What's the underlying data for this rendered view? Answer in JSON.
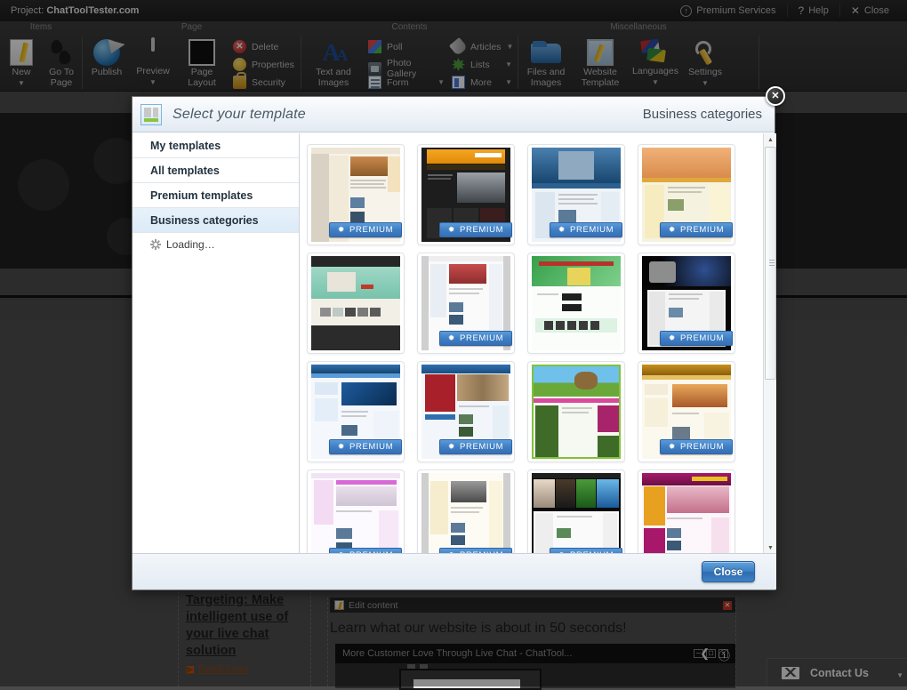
{
  "projectbar": {
    "project_label": "Project:",
    "project_name": "ChatToolTester.com",
    "premium_services": "Premium Services",
    "help": "Help",
    "close": "Close"
  },
  "ribbon": {
    "groups": [
      {
        "label": "Items"
      },
      {
        "label": "Page"
      },
      {
        "label": "Contents"
      },
      {
        "label": "Miscellaneous"
      }
    ],
    "buttons": {
      "new": "New",
      "go_to_page": "Go To\nPage",
      "publish": "Publish",
      "preview": "Preview",
      "page_layout": "Page\nLayout",
      "text_and_images": "Text and\nImages",
      "files_and_images": "Files and\nImages",
      "website_template": "Website\nTemplate",
      "languages": "Languages",
      "settings": "Settings"
    },
    "small_buttons": {
      "delete": "Delete",
      "properties": "Properties",
      "security": "Security",
      "poll": "Poll",
      "photo_gallery": "Photo Gallery",
      "form": "Form",
      "articles": "Articles",
      "lists": "Lists",
      "more": "More"
    }
  },
  "canvas": {
    "promo_title": "Targeting: Make intelligent use of your live chat solution",
    "read_more": "Read more",
    "edit_content": "Edit content",
    "main_heading": "Learn what our website is about in 50 seconds!",
    "video_title": "More Customer Love Through Live Chat - ChatTool...",
    "contact_us": "Contact Us"
  },
  "modal": {
    "title": "Select your template",
    "category": "Business categories",
    "close_button": "Close",
    "close_icon_label": "✕",
    "sidebar": [
      {
        "label": "My templates",
        "active": false
      },
      {
        "label": "All templates",
        "active": false
      },
      {
        "label": "Premium templates",
        "active": false
      },
      {
        "label": "Business categories",
        "active": true
      }
    ],
    "loading_label": "Loading…",
    "badge_label": "PREMIUM",
    "badge_star": "✹",
    "templates": [
      {
        "id": 1,
        "premium": true,
        "style": "cream-wood"
      },
      {
        "id": 2,
        "premium": true,
        "style": "orange-dark"
      },
      {
        "id": 3,
        "premium": true,
        "style": "blue-business"
      },
      {
        "id": 4,
        "premium": true,
        "style": "orange-hands"
      },
      {
        "id": 5,
        "premium": false,
        "style": "mint-dark"
      },
      {
        "id": 6,
        "premium": true,
        "style": "grey-sofa"
      },
      {
        "id": 7,
        "premium": false,
        "style": "green-fresh"
      },
      {
        "id": 8,
        "premium": true,
        "style": "black-tech"
      },
      {
        "id": 9,
        "premium": true,
        "style": "blue-globe"
      },
      {
        "id": 10,
        "premium": true,
        "style": "navy-red-dogs"
      },
      {
        "id": 11,
        "premium": false,
        "style": "green-kids"
      },
      {
        "id": 12,
        "premium": true,
        "style": "beige-city"
      },
      {
        "id": 13,
        "premium": true,
        "style": "pink-light"
      },
      {
        "id": 14,
        "premium": true,
        "style": "yellow-cream"
      },
      {
        "id": 15,
        "premium": true,
        "style": "black-collage"
      },
      {
        "id": 16,
        "premium": false,
        "style": "magenta-travel"
      }
    ]
  }
}
